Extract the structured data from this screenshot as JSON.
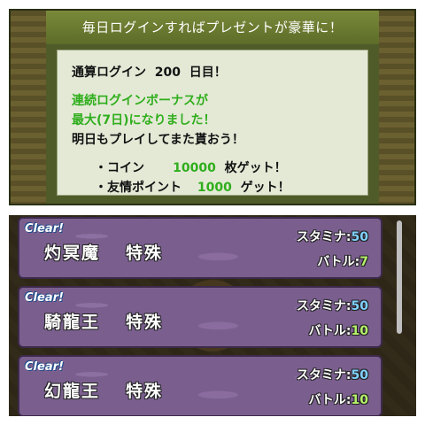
{
  "login": {
    "title": "毎日ログインすればプレゼントが豪華に！",
    "total_label": "通算ログイン",
    "total_days": "200",
    "total_suffix": "日目！",
    "streak_line1": "連続ログインボーナスが",
    "streak_line2": "最大(7日)になりました！",
    "tomorrow": "明日もプレイしてまた貰おう！",
    "rewards": [
      {
        "prefix": "・コイン",
        "value": "10000",
        "suffix": "枚ゲット！"
      },
      {
        "prefix": "・友情ポイント",
        "value": "1000",
        "suffix": "ゲット！"
      }
    ]
  },
  "dungeons": [
    {
      "badge": "Clear!",
      "name": "灼冥魔",
      "type": "特殊",
      "stamina_label": "スタミナ:",
      "stamina": "50",
      "battle_label": "バトル:",
      "battles": "7"
    },
    {
      "badge": "Clear!",
      "name": "騎龍王",
      "type": "特殊",
      "stamina_label": "スタミナ:",
      "stamina": "50",
      "battle_label": "バトル:",
      "battles": "10"
    },
    {
      "badge": "Clear!",
      "name": "幻龍王",
      "type": "特殊",
      "stamina_label": "スタミナ:",
      "stamina": "50",
      "battle_label": "バトル:",
      "battles": "10"
    }
  ]
}
